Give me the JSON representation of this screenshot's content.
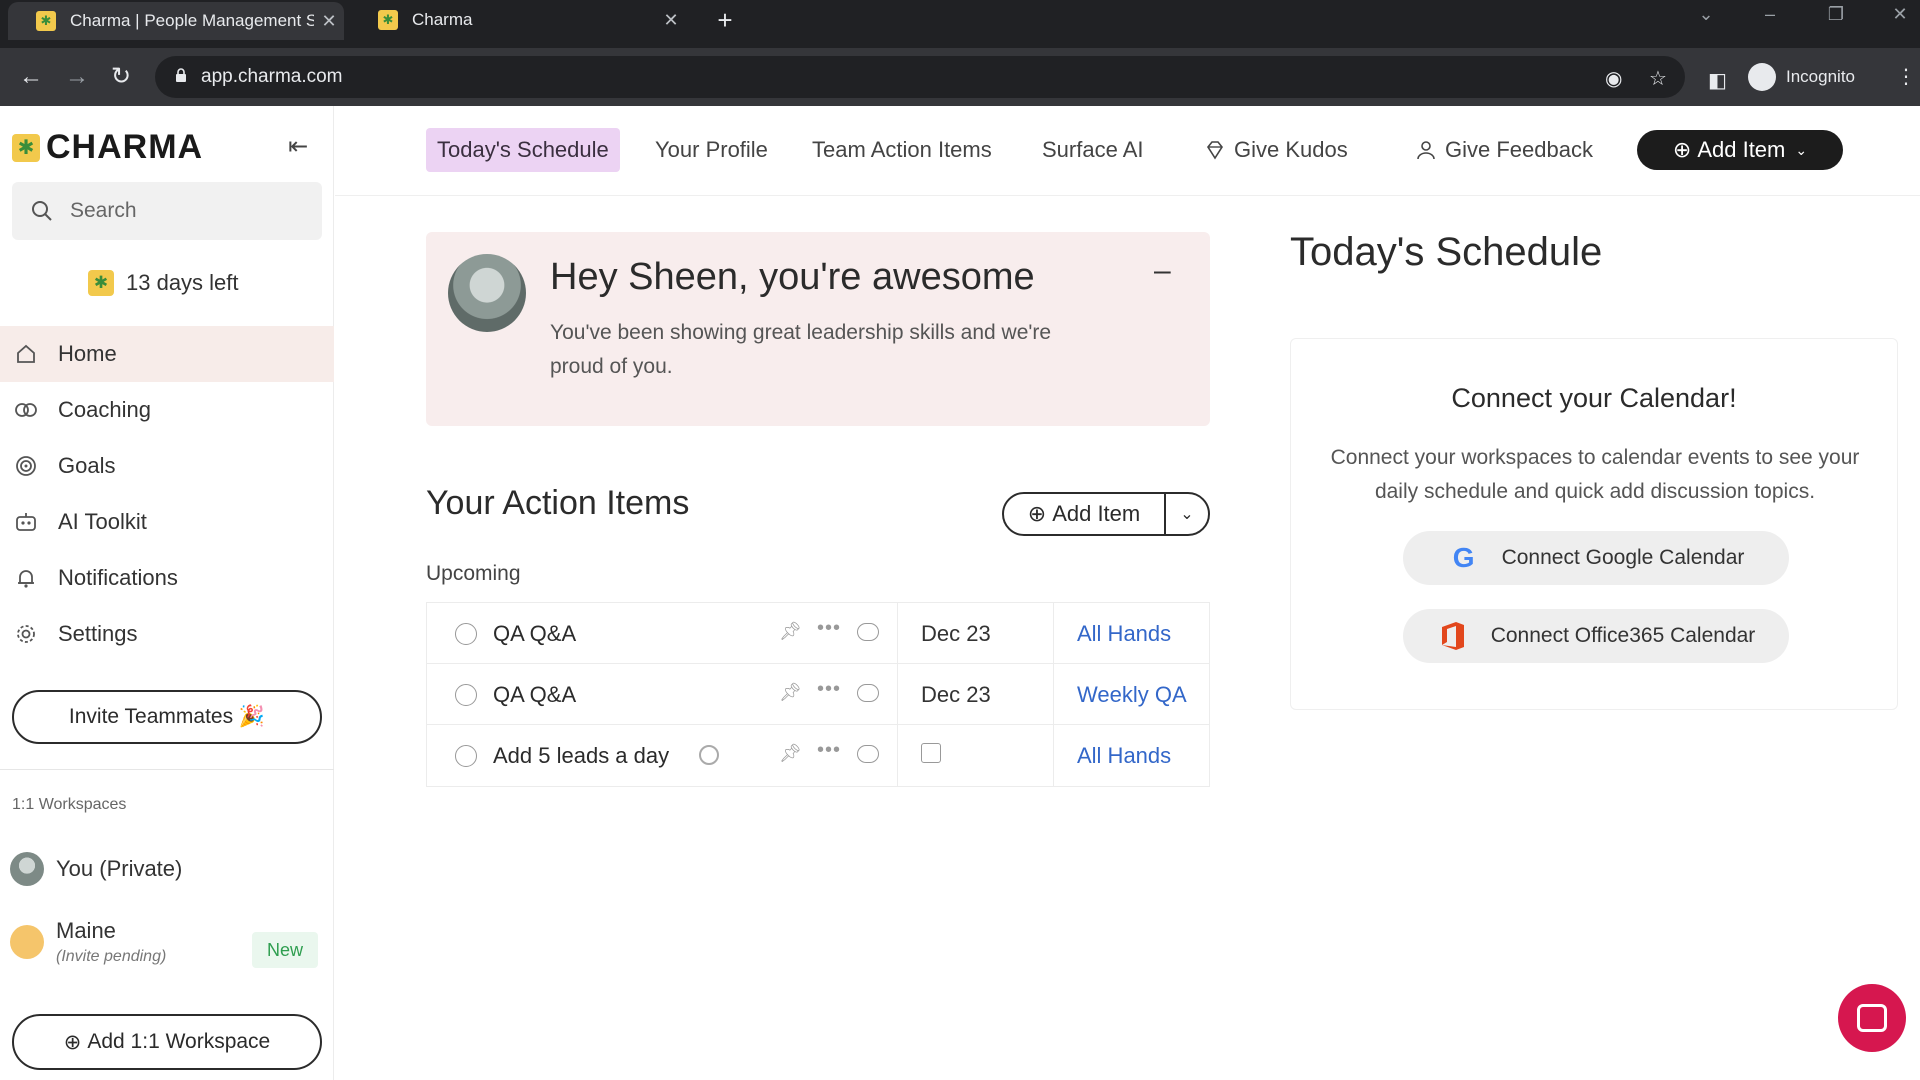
{
  "browser": {
    "tabs": [
      {
        "title": "Charma | People Management S",
        "close": "✕"
      },
      {
        "title": "Charma",
        "close": "✕"
      }
    ],
    "new_tab": "+",
    "url": "app.charma.com",
    "profile_label": "Incognito"
  },
  "sidebar": {
    "logo_text": "CHARMA",
    "search_placeholder": "Search",
    "trial_text": "13 days left",
    "nav": [
      {
        "label": "Home",
        "icon": "home-icon"
      },
      {
        "label": "Coaching",
        "icon": "coaching-icon"
      },
      {
        "label": "Goals",
        "icon": "target-icon"
      },
      {
        "label": "AI Toolkit",
        "icon": "robot-icon"
      },
      {
        "label": "Notifications",
        "icon": "bell-icon"
      },
      {
        "label": "Settings",
        "icon": "gear-icon"
      }
    ],
    "invite_label": "Invite Teammates 🎉",
    "workspaces_label": "1:1 Workspaces",
    "workspaces": [
      {
        "name": "You (Private)",
        "sub": ""
      },
      {
        "name": "Maine",
        "sub": "(Invite pending)",
        "badge": "New"
      }
    ],
    "add_workspace_label": "Add 1:1 Workspace"
  },
  "topnav": {
    "tabs": [
      "Today's Schedule",
      "Your Profile",
      "Team Action Items",
      "Surface AI"
    ],
    "kudos_label": "Give Kudos",
    "feedback_label": "Give Feedback",
    "add_item_label": "Add Item"
  },
  "banner": {
    "title": "Hey Sheen, you're awesome",
    "message": "You've been showing great leadership skills and we're proud of you.",
    "minimize": "–"
  },
  "action_items": {
    "title": "Your Action Items",
    "add_label": "Add Item",
    "group_label": "Upcoming",
    "rows": [
      {
        "title": "QA Q&A",
        "date": "Dec 23",
        "meeting": "All Hands"
      },
      {
        "title": "QA Q&A",
        "date": "Dec 23",
        "meeting": "Weekly QA"
      },
      {
        "title": "Add 5 leads a day",
        "date": "",
        "meeting": "All Hands"
      }
    ]
  },
  "schedule": {
    "title": "Today's Schedule",
    "card_title": "Connect your Calendar!",
    "card_desc": "Connect your workspaces to calendar events to see your daily schedule and quick add discussion topics.",
    "google_label": "Connect Google Calendar",
    "office_label": "Connect Office365 Calendar"
  },
  "colors": {
    "accent_active_tab": "#ecd3f3",
    "banner_bg": "#f8eded",
    "link": "#3367c9",
    "chat_fab": "#d6174f"
  }
}
